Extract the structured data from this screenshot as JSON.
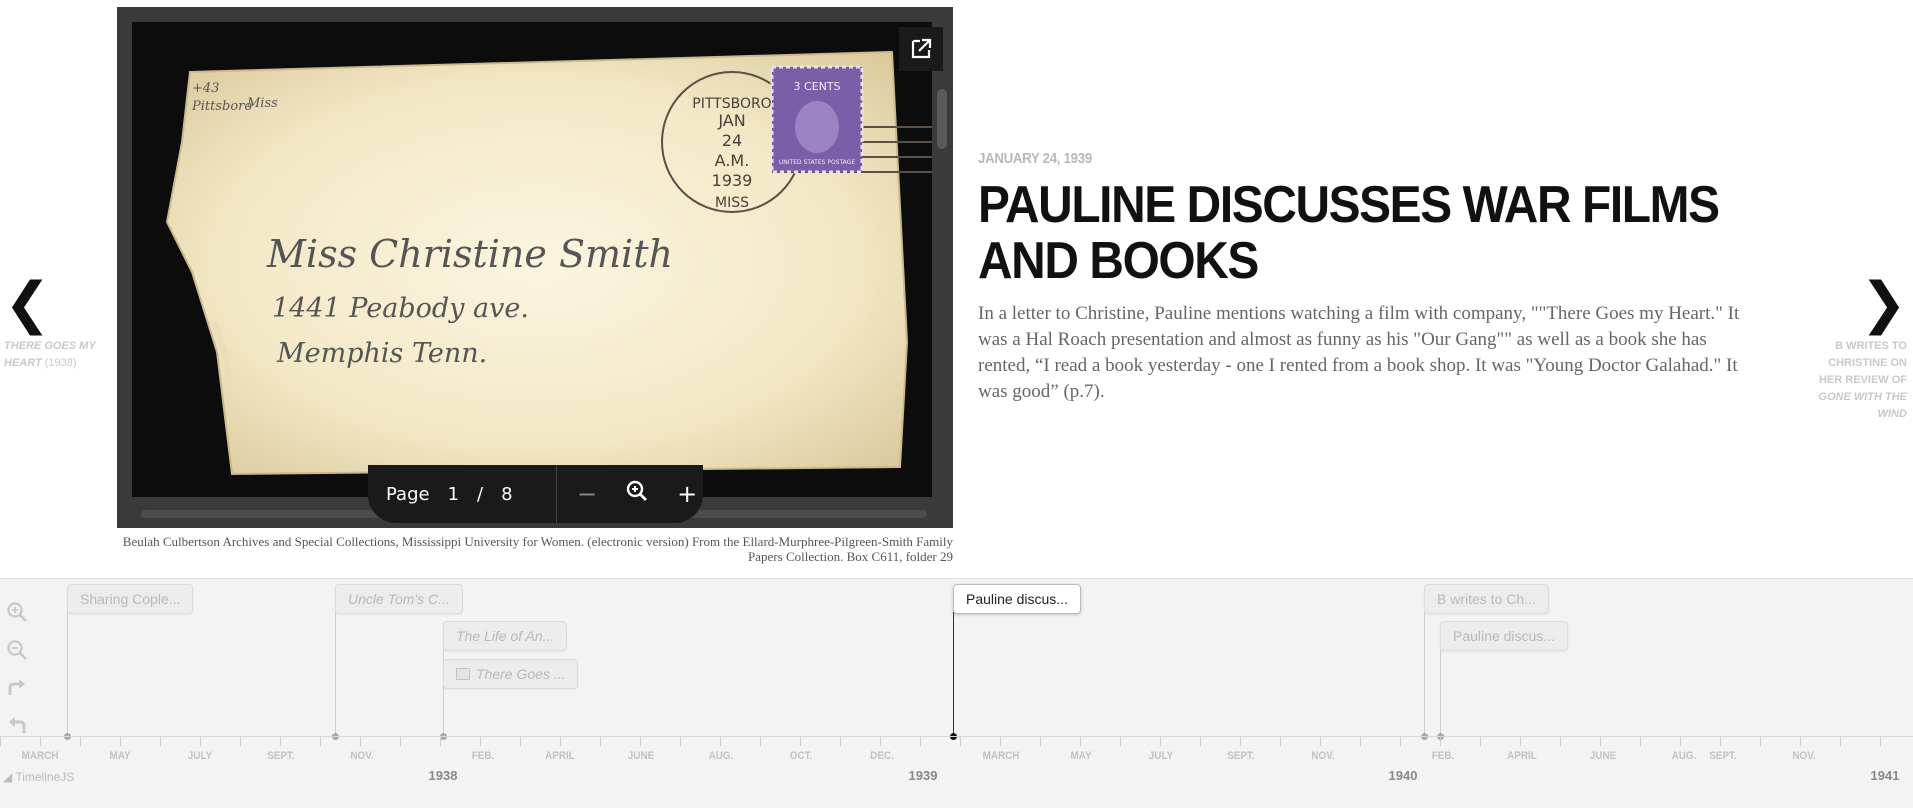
{
  "slide": {
    "date": "JANUARY 24, 1939",
    "headline": "PAULINE DISCUSSES WAR FILMS AND BOOKS",
    "body": "In a letter to Christine, Pauline mentions watching a film with company, \"\"There Goes my Heart.\" It was a Hal Roach presentation and almost as funny as his \"Our Gang\"\" as well as a book she has rented, “I read a book yesterday - one I rented from a book shop. It was \"Young Doctor Galahad.\" It was good” (p.7).",
    "caption": "Beulah Culbertson Archives and Special Collections, Mississippi University for Women. (electronic version) From the Ellard-Murphree-Pilgreen-Smith Family Papers Collection. Box C611, folder 29"
  },
  "nav": {
    "prev_arrow": "❮",
    "prev_title": "There Goes My Heart",
    "prev_year": "(1938)",
    "next_arrow": "❯",
    "next_title_plain": "B writes to Christine on her review of",
    "next_title_italic": "Gone with the Wind"
  },
  "viewer": {
    "page_label": "Page",
    "current_page": "1",
    "separator": "/",
    "total_pages": "8",
    "zoom_out": "−",
    "zoom_in": "+",
    "envelope": {
      "return_addr_1": "+43",
      "return_addr_2": "Pittsboro",
      "return_addr_3": "Miss",
      "address_1": "Miss Christine Smith",
      "address_2": "1441 Peabody ave.",
      "address_3": "Memphis Tenn.",
      "postmark_city": "PITTSBORO",
      "postmark_month": "JAN",
      "postmark_day": "24",
      "postmark_time": "A.M.",
      "postmark_year": "1939",
      "postmark_state": "MISS",
      "stamp_value": "3 CENTS",
      "stamp_text": "UNITED STATES POSTAGE"
    }
  },
  "timeline": {
    "credit": "◢ TimelineJS",
    "events": [
      {
        "label": "Sharing Cople...",
        "italic": false,
        "icon": false,
        "active": false
      },
      {
        "label": "Uncle Tom's C...",
        "italic": true,
        "icon": false,
        "active": false
      },
      {
        "label": "The Life of An...",
        "italic": true,
        "icon": false,
        "active": false
      },
      {
        "label": "There Goes ...",
        "italic": true,
        "icon": true,
        "active": false
      },
      {
        "label": "Pauline discus...",
        "italic": false,
        "icon": false,
        "active": true
      },
      {
        "label": "B writes to Ch...",
        "italic": false,
        "icon": false,
        "active": false
      },
      {
        "label": "Pauline discus...",
        "italic": false,
        "icon": false,
        "active": false
      }
    ],
    "months": [
      "MARCH",
      "MAY",
      "JULY",
      "SEPT.",
      "NOV.",
      "FEB.",
      "APRIL",
      "JUNE",
      "AUG.",
      "OCT.",
      "DEC.",
      "MARCH",
      "MAY",
      "JULY",
      "SEPT.",
      "NOV.",
      "FEB.",
      "APRIL",
      "JUNE",
      "AUG.",
      "SEPT.",
      "NOV."
    ],
    "years": [
      "1938",
      "1939",
      "1940",
      "1941"
    ]
  },
  "colors": {
    "headline": "#111111",
    "date": "#b8b8b8",
    "body": "#666666",
    "timeline_bg": "#f3f3f3",
    "stamp": "#7a5ea8"
  }
}
